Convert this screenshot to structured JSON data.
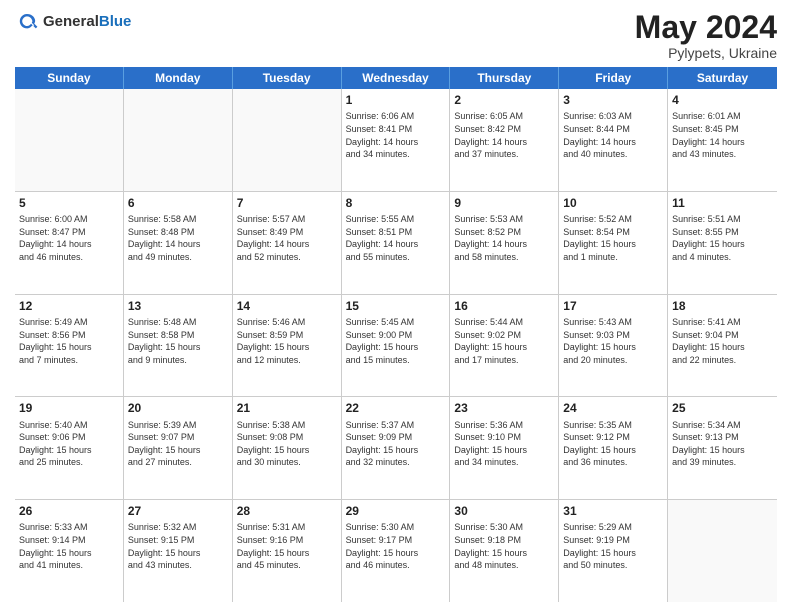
{
  "logo": {
    "general": "General",
    "blue": "Blue"
  },
  "title": {
    "month_year": "May 2024",
    "location": "Pylypets, Ukraine"
  },
  "weekdays": [
    "Sunday",
    "Monday",
    "Tuesday",
    "Wednesday",
    "Thursday",
    "Friday",
    "Saturday"
  ],
  "rows": [
    [
      {
        "day": "",
        "lines": []
      },
      {
        "day": "",
        "lines": []
      },
      {
        "day": "",
        "lines": []
      },
      {
        "day": "1",
        "lines": [
          "Sunrise: 6:06 AM",
          "Sunset: 8:41 PM",
          "Daylight: 14 hours",
          "and 34 minutes."
        ]
      },
      {
        "day": "2",
        "lines": [
          "Sunrise: 6:05 AM",
          "Sunset: 8:42 PM",
          "Daylight: 14 hours",
          "and 37 minutes."
        ]
      },
      {
        "day": "3",
        "lines": [
          "Sunrise: 6:03 AM",
          "Sunset: 8:44 PM",
          "Daylight: 14 hours",
          "and 40 minutes."
        ]
      },
      {
        "day": "4",
        "lines": [
          "Sunrise: 6:01 AM",
          "Sunset: 8:45 PM",
          "Daylight: 14 hours",
          "and 43 minutes."
        ]
      }
    ],
    [
      {
        "day": "5",
        "lines": [
          "Sunrise: 6:00 AM",
          "Sunset: 8:47 PM",
          "Daylight: 14 hours",
          "and 46 minutes."
        ]
      },
      {
        "day": "6",
        "lines": [
          "Sunrise: 5:58 AM",
          "Sunset: 8:48 PM",
          "Daylight: 14 hours",
          "and 49 minutes."
        ]
      },
      {
        "day": "7",
        "lines": [
          "Sunrise: 5:57 AM",
          "Sunset: 8:49 PM",
          "Daylight: 14 hours",
          "and 52 minutes."
        ]
      },
      {
        "day": "8",
        "lines": [
          "Sunrise: 5:55 AM",
          "Sunset: 8:51 PM",
          "Daylight: 14 hours",
          "and 55 minutes."
        ]
      },
      {
        "day": "9",
        "lines": [
          "Sunrise: 5:53 AM",
          "Sunset: 8:52 PM",
          "Daylight: 14 hours",
          "and 58 minutes."
        ]
      },
      {
        "day": "10",
        "lines": [
          "Sunrise: 5:52 AM",
          "Sunset: 8:54 PM",
          "Daylight: 15 hours",
          "and 1 minute."
        ]
      },
      {
        "day": "11",
        "lines": [
          "Sunrise: 5:51 AM",
          "Sunset: 8:55 PM",
          "Daylight: 15 hours",
          "and 4 minutes."
        ]
      }
    ],
    [
      {
        "day": "12",
        "lines": [
          "Sunrise: 5:49 AM",
          "Sunset: 8:56 PM",
          "Daylight: 15 hours",
          "and 7 minutes."
        ]
      },
      {
        "day": "13",
        "lines": [
          "Sunrise: 5:48 AM",
          "Sunset: 8:58 PM",
          "Daylight: 15 hours",
          "and 9 minutes."
        ]
      },
      {
        "day": "14",
        "lines": [
          "Sunrise: 5:46 AM",
          "Sunset: 8:59 PM",
          "Daylight: 15 hours",
          "and 12 minutes."
        ]
      },
      {
        "day": "15",
        "lines": [
          "Sunrise: 5:45 AM",
          "Sunset: 9:00 PM",
          "Daylight: 15 hours",
          "and 15 minutes."
        ]
      },
      {
        "day": "16",
        "lines": [
          "Sunrise: 5:44 AM",
          "Sunset: 9:02 PM",
          "Daylight: 15 hours",
          "and 17 minutes."
        ]
      },
      {
        "day": "17",
        "lines": [
          "Sunrise: 5:43 AM",
          "Sunset: 9:03 PM",
          "Daylight: 15 hours",
          "and 20 minutes."
        ]
      },
      {
        "day": "18",
        "lines": [
          "Sunrise: 5:41 AM",
          "Sunset: 9:04 PM",
          "Daylight: 15 hours",
          "and 22 minutes."
        ]
      }
    ],
    [
      {
        "day": "19",
        "lines": [
          "Sunrise: 5:40 AM",
          "Sunset: 9:06 PM",
          "Daylight: 15 hours",
          "and 25 minutes."
        ]
      },
      {
        "day": "20",
        "lines": [
          "Sunrise: 5:39 AM",
          "Sunset: 9:07 PM",
          "Daylight: 15 hours",
          "and 27 minutes."
        ]
      },
      {
        "day": "21",
        "lines": [
          "Sunrise: 5:38 AM",
          "Sunset: 9:08 PM",
          "Daylight: 15 hours",
          "and 30 minutes."
        ]
      },
      {
        "day": "22",
        "lines": [
          "Sunrise: 5:37 AM",
          "Sunset: 9:09 PM",
          "Daylight: 15 hours",
          "and 32 minutes."
        ]
      },
      {
        "day": "23",
        "lines": [
          "Sunrise: 5:36 AM",
          "Sunset: 9:10 PM",
          "Daylight: 15 hours",
          "and 34 minutes."
        ]
      },
      {
        "day": "24",
        "lines": [
          "Sunrise: 5:35 AM",
          "Sunset: 9:12 PM",
          "Daylight: 15 hours",
          "and 36 minutes."
        ]
      },
      {
        "day": "25",
        "lines": [
          "Sunrise: 5:34 AM",
          "Sunset: 9:13 PM",
          "Daylight: 15 hours",
          "and 39 minutes."
        ]
      }
    ],
    [
      {
        "day": "26",
        "lines": [
          "Sunrise: 5:33 AM",
          "Sunset: 9:14 PM",
          "Daylight: 15 hours",
          "and 41 minutes."
        ]
      },
      {
        "day": "27",
        "lines": [
          "Sunrise: 5:32 AM",
          "Sunset: 9:15 PM",
          "Daylight: 15 hours",
          "and 43 minutes."
        ]
      },
      {
        "day": "28",
        "lines": [
          "Sunrise: 5:31 AM",
          "Sunset: 9:16 PM",
          "Daylight: 15 hours",
          "and 45 minutes."
        ]
      },
      {
        "day": "29",
        "lines": [
          "Sunrise: 5:30 AM",
          "Sunset: 9:17 PM",
          "Daylight: 15 hours",
          "and 46 minutes."
        ]
      },
      {
        "day": "30",
        "lines": [
          "Sunrise: 5:30 AM",
          "Sunset: 9:18 PM",
          "Daylight: 15 hours",
          "and 48 minutes."
        ]
      },
      {
        "day": "31",
        "lines": [
          "Sunrise: 5:29 AM",
          "Sunset: 9:19 PM",
          "Daylight: 15 hours",
          "and 50 minutes."
        ]
      },
      {
        "day": "",
        "lines": []
      }
    ]
  ]
}
